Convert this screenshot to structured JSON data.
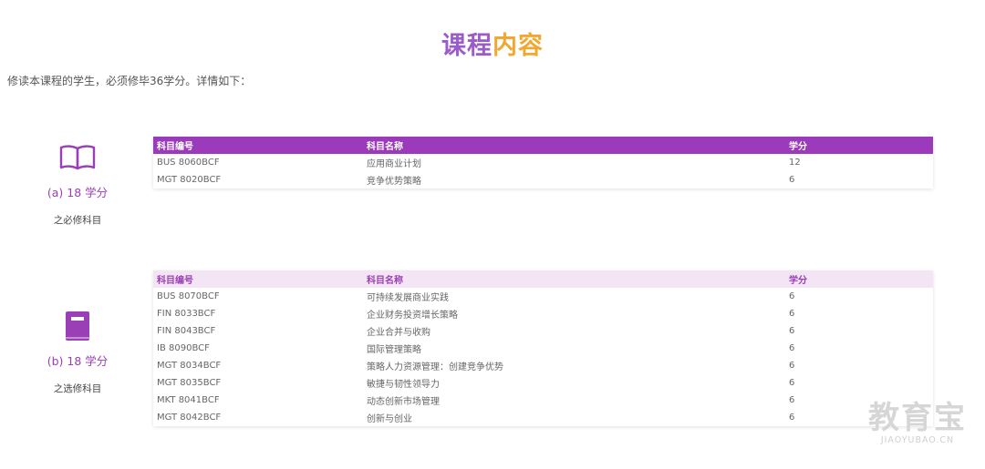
{
  "header": {
    "title_part1": "课程",
    "title_part2": "内容",
    "intro": "修读本课程的学生，必须修毕36学分。详情如下："
  },
  "required": {
    "icon": "open-book-icon",
    "credits": "(a) 18 学分",
    "label": "之必修科目",
    "columns": [
      "科目编号",
      "科目名称",
      "学分"
    ],
    "rows": [
      [
        "BUS 8060BCF",
        "应用商业计划",
        "12"
      ],
      [
        "MGT 8020BCF",
        "竞争优势策略",
        "6"
      ]
    ]
  },
  "elective": {
    "icon": "closed-book-icon",
    "credits": "(b) 18 学分",
    "label": "之选修科目",
    "columns": [
      "科目编号",
      "科目名称",
      "学分"
    ],
    "rows": [
      [
        "BUS 8070BCF",
        "可持续发展商业实践",
        "6"
      ],
      [
        "FIN 8033BCF",
        "企业财务投资增长策略",
        "6"
      ],
      [
        "FIN 8043BCF",
        "企业合并与收购",
        "6"
      ],
      [
        "IB 8090BCF",
        "国际管理策略",
        "6"
      ],
      [
        "MGT 8034BCF",
        "策略人力资源管理：创建竞争优势",
        "6"
      ],
      [
        "MGT 8035BCF",
        "敏捷与韧性领导力",
        "6"
      ],
      [
        "MKT 8041BCF",
        "动态创新市场管理",
        "6"
      ],
      [
        "MGT 8042BCF",
        "创新与创业",
        "6"
      ]
    ]
  },
  "watermark": {
    "main": "教育宝",
    "url": "JIAOYUBAO.CN"
  },
  "colors": {
    "purple": "#9b3bbb",
    "orange": "#f0a830",
    "light_purple": "#f3e5f3"
  }
}
